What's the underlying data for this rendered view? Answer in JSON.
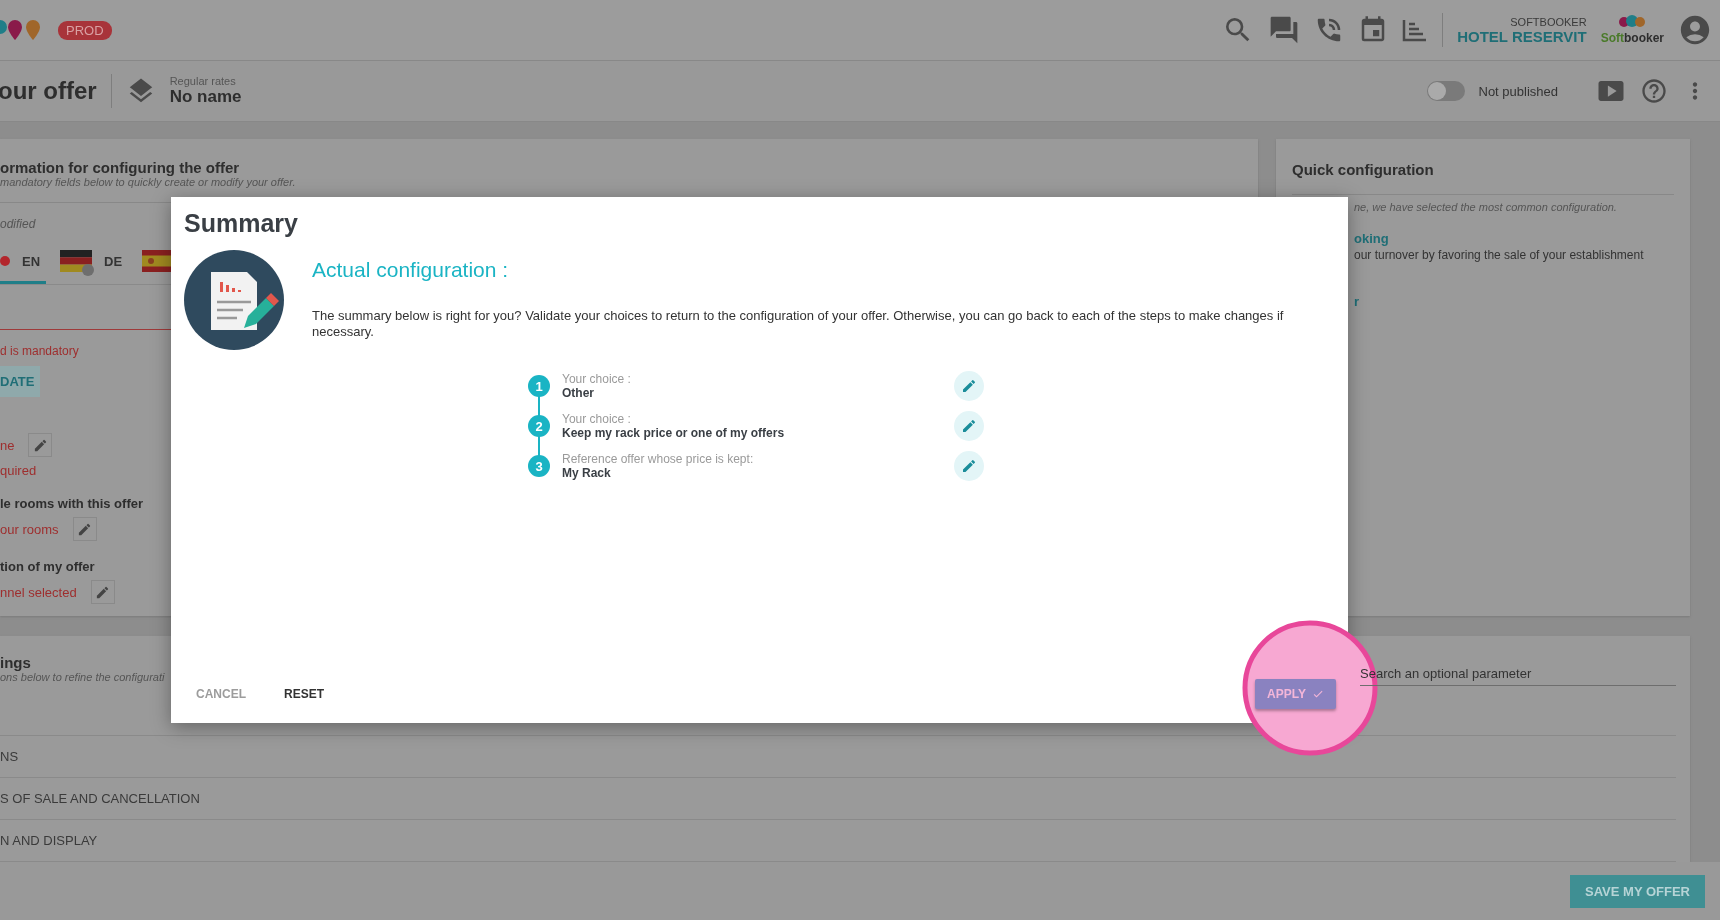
{
  "top_bar": {
    "env_badge": "PROD",
    "account": {
      "company": "SOFTBOOKER",
      "hotel": "HOTEL RESERVIT"
    },
    "logo_text": [
      "Soft",
      "booker"
    ]
  },
  "header": {
    "title": "our offer",
    "rate_type": "Regular rates",
    "rate_name": "No name",
    "publish_toggle": {
      "on": false,
      "label": "Not published"
    }
  },
  "config_card": {
    "title": "ormation for configuring the offer",
    "subtitle": "mandatory fields below to quickly create or modify your offer.",
    "modified_note": "odified",
    "tabs": [
      {
        "kind": "dot",
        "label": "EN",
        "selected": true,
        "color": "#b3262c"
      },
      {
        "kind": "de-flag",
        "label": "DE",
        "selected": false
      },
      {
        "kind": "es-flag",
        "selected": false
      }
    ],
    "error": "d is mandatory",
    "update_button": "DATE",
    "items": [
      {
        "value": "ne",
        "note": "quired"
      },
      {
        "heading": "le rooms with this offer",
        "value": "our rooms"
      },
      {
        "heading": "tion of my offer",
        "value": "nnel selected"
      }
    ]
  },
  "quick_config": {
    "title": "Quick configuration",
    "intro": "ne, we have selected the most common configuration.",
    "option_title": "oking",
    "option_text": "our turnover by favoring the sale of your establishment",
    "option_2_title": "r"
  },
  "settings_card": {
    "title": "ings",
    "subtitle": "ons below to refine the configurati",
    "search": {
      "placeholder": "Search an optional parameter"
    },
    "rows": [
      "NS",
      "S OF SALE AND CANCELLATION",
      "N AND DISPLAY"
    ]
  },
  "footer": {
    "save_button": "SAVE MY OFFER"
  },
  "dialog": {
    "title": "Summary",
    "heading": "Actual configuration :",
    "text": "The summary below is right for you? Validate your choices to return to the configuration of your offer. Otherwise, you can go back to each of the steps to make changes if necessary.",
    "steps": [
      {
        "number": "1",
        "label": "Your choice :",
        "value": "Other"
      },
      {
        "number": "2",
        "label": "Your choice :",
        "value": "Keep my rack price or one of my offers"
      },
      {
        "number": "3",
        "label": "Reference offer whose price is kept:",
        "value": "My Rack"
      }
    ],
    "cancel": {
      "label": "CANCEL",
      "disabled": true
    },
    "reset": {
      "label": "RESET",
      "disabled": false
    },
    "apply": {
      "label": "APPLY",
      "highlighted": true
    }
  }
}
